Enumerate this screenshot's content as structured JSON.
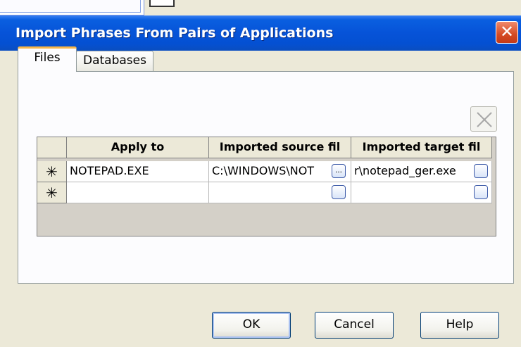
{
  "dialog": {
    "title": "Import Phrases From Pairs of Applications",
    "close_glyph": "✕"
  },
  "tabs": [
    {
      "label": "Files",
      "active": true
    },
    {
      "label": "Databases",
      "active": false
    }
  ],
  "grid": {
    "columns": [
      "Apply to",
      "Imported source fil",
      "Imported target fil"
    ],
    "rows": [
      {
        "marker": "✳",
        "apply_to": "NOTEPAD.EXE",
        "source": "C:\\WINDOWS\\NOT",
        "target": "r\\notepad_ger.exe"
      },
      {
        "marker": "✳",
        "apply_to": "",
        "source": "",
        "target": ""
      }
    ],
    "browse_glyph": "..."
  },
  "buttons": {
    "ok": "OK",
    "cancel": "Cancel",
    "help": "Help"
  },
  "icons": {
    "delete": "delete-x-icon",
    "close": "close-icon"
  },
  "colors": {
    "titlebar": "#0653d8",
    "dialog_bg": "#ece9d8",
    "close_button": "#d54b24"
  }
}
